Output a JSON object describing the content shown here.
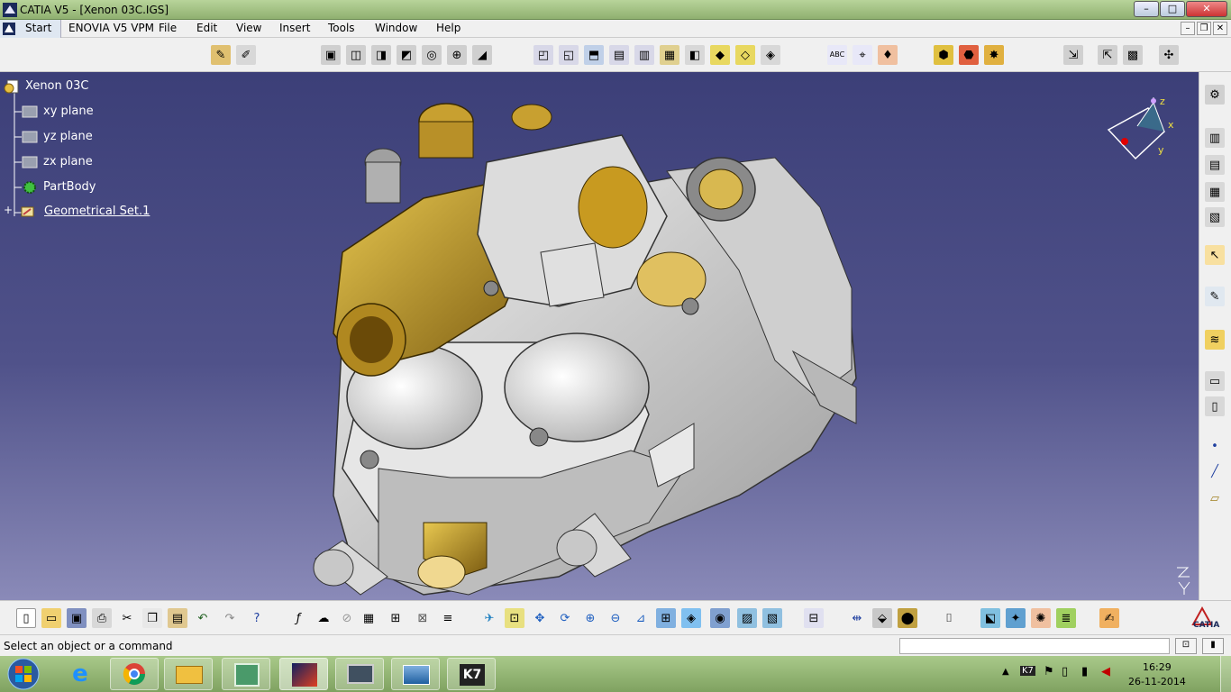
{
  "window": {
    "title": "CATIA V5 - [Xenon 03C.IGS]",
    "min": "–",
    "max": "□",
    "close": "✕"
  },
  "menu": {
    "items": [
      "Start",
      "ENOVIA V5 VPM",
      "File",
      "Edit",
      "View",
      "Insert",
      "Tools",
      "Window",
      "Help"
    ]
  },
  "mdi": {
    "min": "–",
    "restore": "❐",
    "close": "✕"
  },
  "tree": {
    "root": "Xenon 03C",
    "items": [
      "xy plane",
      "yz plane",
      "zx plane",
      "PartBody",
      "Geometrical Set.1"
    ]
  },
  "compass": {
    "z": "z",
    "x": "x",
    "y": "y"
  },
  "statusbar": {
    "message": "Select an object or a command"
  },
  "taskbar": {
    "time": "16:29",
    "date": "26-11-2014",
    "k7_label": "K7"
  },
  "brand": {
    "logo_text": "CATIA"
  },
  "colors": {
    "viewport_top": "#3c3f78",
    "viewport_bottom": "#8a8ab8",
    "part_grey": "#d8d8d8",
    "brass": "#b8962a",
    "title_green": "#a9c98a"
  }
}
